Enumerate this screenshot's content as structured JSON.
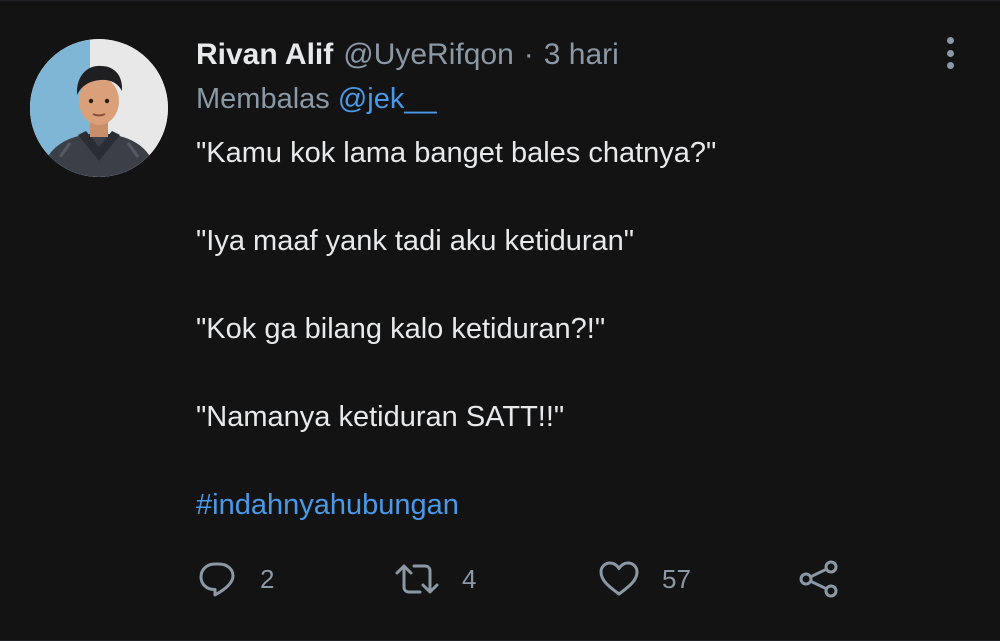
{
  "tweet": {
    "author_name": "Rivan Alif",
    "author_handle": "@UyeRifqon",
    "separator": "·",
    "timestamp": "3 hari",
    "reply_label": "Membalas",
    "reply_mention": "@jek__",
    "lines": [
      "\"Kamu kok lama banget bales chatnya?\"",
      "\"Iya maaf yank tadi aku ketiduran\"",
      "\"Kok ga bilang kalo ketiduran?!\"",
      "\"Namanya ketiduran SATT!!\""
    ],
    "hashtag": "#indahnyahubungan"
  },
  "actions": {
    "reply_count": "2",
    "retweet_count": "4",
    "like_count": "57"
  },
  "icons": {
    "more": "more-vertical-icon",
    "reply": "reply-bubble-icon",
    "retweet": "retweet-icon",
    "like": "heart-icon",
    "share": "share-icon"
  },
  "colors": {
    "background": "#131314",
    "text": "#e7e9ea",
    "muted": "#8b98a5",
    "accent": "#4a99e9"
  }
}
